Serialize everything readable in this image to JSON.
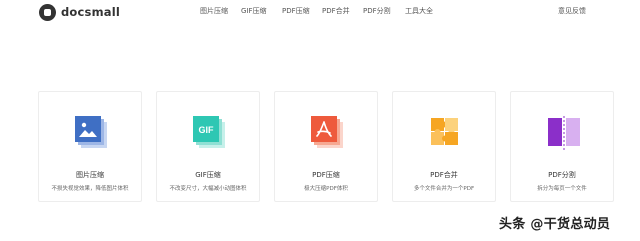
{
  "header": {
    "logo_text": "docsmall",
    "nav": [
      "图片压缩",
      "GIF压缩",
      "PDF压缩",
      "PDF合并",
      "PDF分割",
      "工具大全"
    ],
    "feedback": "意见反馈"
  },
  "tools": [
    {
      "title": "图片压缩",
      "desc": "不损失视觉效果，降低图片体积",
      "icon": "image-icon",
      "color": "#3f6fc4"
    },
    {
      "title": "GIF压缩",
      "desc": "不改变尺寸，大幅减小动图体积",
      "icon": "gif-icon",
      "color": "#2ec7b3",
      "icon_text": "GIF"
    },
    {
      "title": "PDF压缩",
      "desc": "极大压缩PDF体积",
      "icon": "pdf-icon",
      "color": "#ee5a3c"
    },
    {
      "title": "PDF合并",
      "desc": "多个文件合并为一个PDF",
      "icon": "puzzle-icon",
      "color": "#f6a623"
    },
    {
      "title": "PDF分割",
      "desc": "拆分为每页一个文件",
      "icon": "split-icon",
      "color": "#8b2fc9"
    }
  ],
  "watermark": "头条 @干货总动员"
}
